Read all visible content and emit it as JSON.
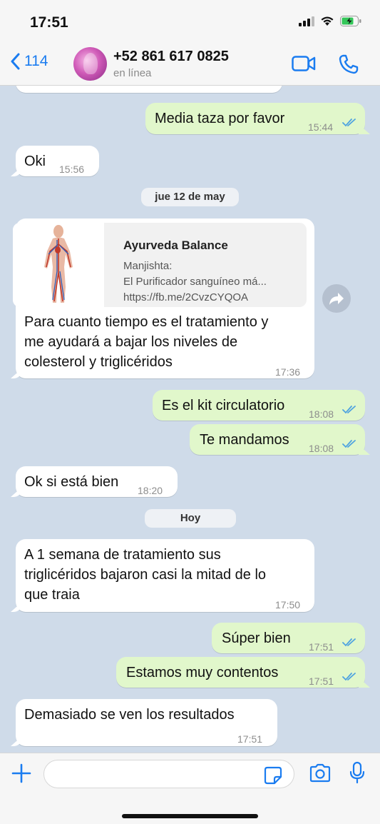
{
  "status_bar": {
    "time": "17:51"
  },
  "header": {
    "back_count": "114",
    "contact_name": "+52 861 617 0825",
    "contact_status": "en línea"
  },
  "messages": {
    "m1": {
      "text": "Media taza por favor",
      "time": "15:44"
    },
    "m2": {
      "text": "Oki",
      "time": "15:56"
    },
    "date1": "jue 12 de may",
    "link": {
      "title": "Ayurveda Balance",
      "line1": "Manjishta:",
      "line2": "El Purificador sanguíneo má...",
      "url": "https://fb.me/2CvzCYQOA"
    },
    "m3": {
      "line1": "Para cuanto tiempo es el tratamiento y",
      "line2": "me ayudará a bajar los niveles de",
      "line3": "colesterol y triglicéridos",
      "time": "17:36"
    },
    "m4": {
      "text": "Es el kit circulatorio",
      "time": "18:08"
    },
    "m5": {
      "text": "Te mandamos",
      "time": "18:08"
    },
    "m6": {
      "text": "Ok si está bien",
      "time": "18:20"
    },
    "date2": "Hoy",
    "m7": {
      "line1": "A 1 semana de tratamiento sus",
      "line2": "triglicéridos bajaron casi la mitad de lo",
      "line3": "que traia",
      "time": "17:50"
    },
    "m8": {
      "text": "Súper bien",
      "time": "17:51"
    },
    "m9": {
      "text": "Estamos muy contentos",
      "time": "17:51"
    },
    "m10": {
      "text": "Demasiado se ven los resultados",
      "time": "17:51"
    }
  },
  "colors": {
    "accent": "#1a7cf0",
    "outgoing_bubble": "#e1f7cb",
    "incoming_bubble": "#ffffff",
    "chat_background": "#cfdbe9",
    "read_ticks": "#4fa3e0"
  },
  "icons": [
    "back-chevron-icon",
    "video-call-icon",
    "phone-icon",
    "forward-icon",
    "plus-icon",
    "sticker-icon",
    "camera-icon",
    "microphone-icon",
    "signal-icon",
    "wifi-icon",
    "battery-icon"
  ]
}
